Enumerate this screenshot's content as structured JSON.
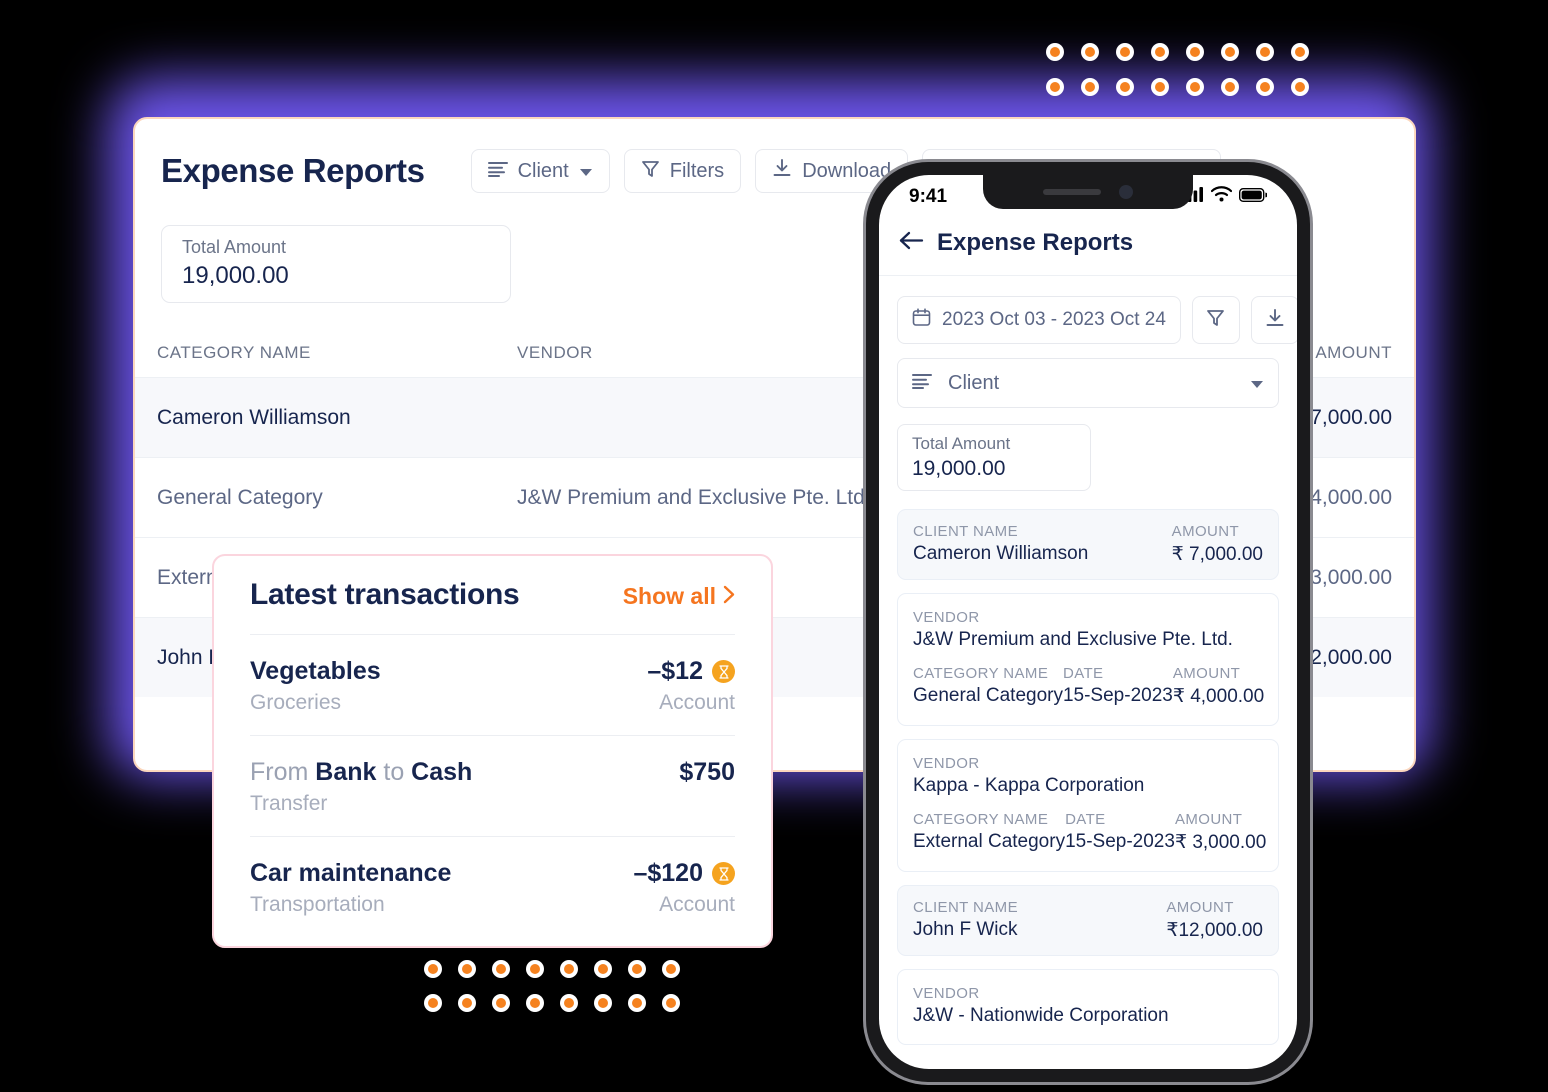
{
  "desktop": {
    "title": "Expense Reports",
    "controls": {
      "sort_label": "Client",
      "filters_label": "Filters",
      "download_label": "Download",
      "date_range": "2023 Oct 03 - 2023 Oct 24"
    },
    "total": {
      "label": "Total Amount",
      "value": "19,000.00"
    },
    "table": {
      "headers": {
        "category": "CATEGORY NAME",
        "vendor": "VENDOR",
        "amount": "AMOUNT"
      },
      "rows": [
        {
          "category": "Cameron Williamson",
          "vendor": "",
          "amount": "7,000.00",
          "highlight": true
        },
        {
          "category": "General Category",
          "vendor": "J&W Premium and Exclusive Pte. Ltd.",
          "amount": "4,000.00",
          "highlight": false
        },
        {
          "category": "External Category",
          "vendor": "Kappa - Kappa Corporation",
          "amount": "3,000.00",
          "highlight": false
        },
        {
          "category": "John F Wick",
          "vendor": "",
          "amount": "12,000.00",
          "highlight": true
        }
      ]
    }
  },
  "latest": {
    "title": "Latest transactions",
    "show_all": "Show all",
    "chevron": "›",
    "rows": [
      {
        "name": "Vegetables",
        "sub": "Groceries",
        "amount": "–$12",
        "meta": "Account",
        "badge": true,
        "transfer": false
      },
      {
        "name_prefix": "From ",
        "name_a": "Bank",
        "name_mid": " to ",
        "name_b": "Cash",
        "sub": "Transfer",
        "amount": "$750",
        "meta": "",
        "badge": false,
        "transfer": true
      },
      {
        "name": "Car maintenance",
        "sub": "Transportation",
        "amount": "–$120",
        "meta": "Account",
        "badge": true,
        "transfer": false
      }
    ]
  },
  "phone": {
    "status": {
      "time": "9:41"
    },
    "header": {
      "back": "←",
      "title": "Expense Reports"
    },
    "toolbar": {
      "date_range": "2023 Oct 03 - 2023 Oct 24",
      "filter_icon": "filter-icon",
      "download_icon": "download-icon"
    },
    "select": {
      "value": "Client"
    },
    "total": {
      "label": "Total Amount",
      "value": "19,000.00"
    },
    "labels": {
      "client_name": "CLIENT NAME",
      "amount": "AMOUNT",
      "vendor": "VENDOR",
      "category_name": "CATEGORY NAME",
      "date": "DATE"
    },
    "cards": [
      {
        "type": "client",
        "client": "Cameron Williamson",
        "amount": "₹ 7,000.00"
      },
      {
        "type": "vendor",
        "vendor": "J&W Premium and Exclusive Pte. Ltd.",
        "category": "General Category",
        "date": "15-Sep-2023",
        "amount": "₹ 4,000.00"
      },
      {
        "type": "vendor",
        "vendor": "Kappa - Kappa Corporation",
        "category": "External Category",
        "date": "15-Sep-2023",
        "amount": "₹ 3,000.00"
      },
      {
        "type": "client",
        "client": "John F Wick",
        "amount": "₹12,000.00"
      },
      {
        "type": "vendor",
        "vendor": "J&W - Nationwide Corporation",
        "category": "",
        "date": "",
        "amount": ""
      }
    ]
  },
  "colors": {
    "purple_glow": "#6B54E8",
    "accent_orange": "#F5751F",
    "badge_orange": "#F5A31F",
    "navy": "#17254E",
    "card_border": "#FBD7BE",
    "popover_border": "#FBD5DE"
  }
}
